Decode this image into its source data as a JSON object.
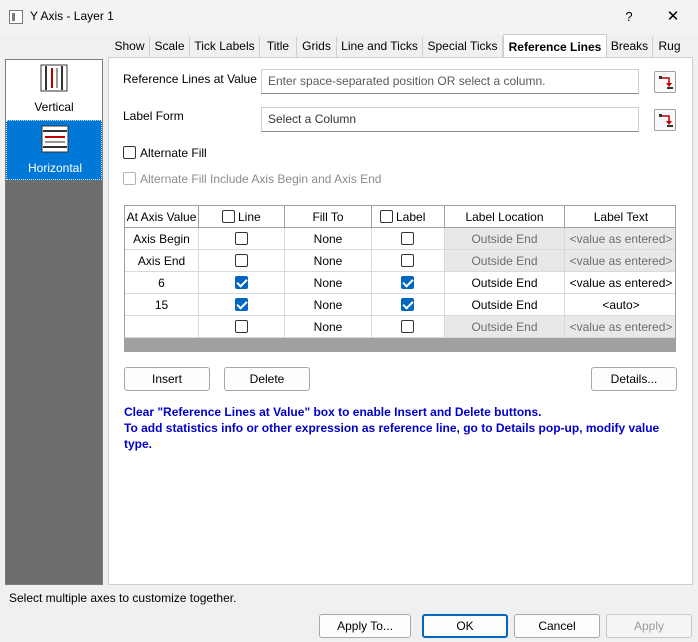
{
  "window": {
    "title": "Y Axis - Layer 1",
    "help_label": "?",
    "close_label": "✕"
  },
  "sidebar": {
    "items": [
      {
        "label": "Vertical",
        "icon": "vertical-axis-icon"
      },
      {
        "label": "Horizontal",
        "icon": "horizontal-axis-icon",
        "selected": true
      }
    ]
  },
  "tabs": [
    "Show",
    "Scale",
    "Tick Labels",
    "Title",
    "Grids",
    "Line and Ticks",
    "Special Ticks",
    "Reference Lines",
    "Breaks",
    "Rug"
  ],
  "active_tab": "Reference Lines",
  "form": {
    "ref_lines_label": "Reference Lines at Value",
    "ref_lines_placeholder": "Enter space-separated position OR select a column.",
    "label_form_label": "Label Form",
    "label_form_value": "Select a Column",
    "alternate_fill": "Alternate Fill",
    "alternate_fill_include": "Alternate Fill Include Axis Begin and Axis End"
  },
  "table": {
    "headers": {
      "at_axis_value": "At Axis Value",
      "line": "Line",
      "fill_to": "Fill To",
      "label": "Label",
      "label_location": "Label Location",
      "label_text": "Label Text"
    },
    "rows": [
      {
        "value": "Axis Begin",
        "line": false,
        "fill_to": "None",
        "label": false,
        "location": "Outside End",
        "text": "<value as entered>",
        "enabled": false
      },
      {
        "value": "Axis End",
        "line": false,
        "fill_to": "None",
        "label": false,
        "location": "Outside End",
        "text": "<value as entered>",
        "enabled": false
      },
      {
        "value": "6",
        "line": true,
        "fill_to": "None",
        "label": true,
        "location": "Outside End",
        "text": "<value as entered>",
        "enabled": true
      },
      {
        "value": "15",
        "line": true,
        "fill_to": "None",
        "label": true,
        "location": "Outside End",
        "text": "<auto>",
        "enabled": true
      },
      {
        "value": "",
        "line": false,
        "fill_to": "None",
        "label": false,
        "location": "Outside End",
        "text": "<value as entered>",
        "enabled": false
      }
    ]
  },
  "buttons": {
    "insert": "Insert",
    "delete": "Delete",
    "details": "Details..."
  },
  "info": {
    "line1": "Clear \"Reference Lines at Value\" box to enable Insert and Delete buttons.",
    "line2": "To add statistics info or other expression as reference line, go to Details pop-up, modify value type."
  },
  "status": "Select multiple axes to customize together.",
  "footer": {
    "apply_to": "Apply To...",
    "ok": "OK",
    "cancel": "Cancel",
    "apply": "Apply"
  },
  "colors": {
    "accent": "#0078d7",
    "info_text": "#0000cc",
    "checked": "#0067c0"
  }
}
